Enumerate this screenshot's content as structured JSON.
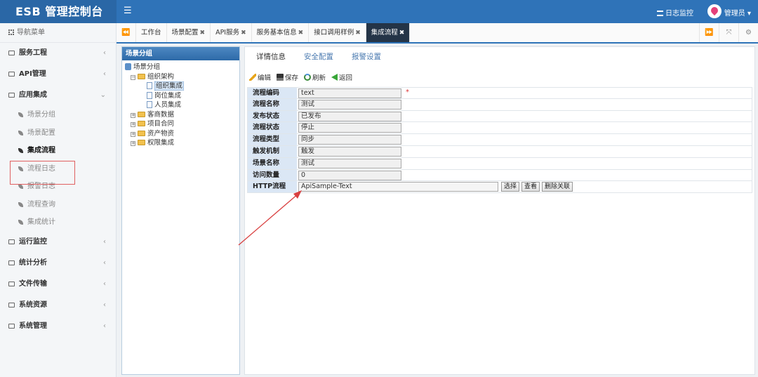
{
  "app": {
    "title": "ESB 管理控制台"
  },
  "header": {
    "menu_icon": "menu-icon",
    "log_monitor": "日志监控",
    "user": "管理员"
  },
  "sidebar": {
    "nav_title": "导航菜单",
    "groups": [
      {
        "label": "服务工程",
        "arrow": "‹"
      },
      {
        "label": "API管理",
        "arrow": "‹"
      },
      {
        "label": "应用集成",
        "arrow": "⌄",
        "expanded": true,
        "items": [
          "场景分组",
          "场景配置",
          "集成流程",
          "流程日志",
          "报警日志",
          "流程查询",
          "集成统计"
        ],
        "active": "集成流程"
      },
      {
        "label": "运行监控",
        "arrow": "‹"
      },
      {
        "label": "统计分析",
        "arrow": "‹"
      },
      {
        "label": "文件传输",
        "arrow": "‹"
      },
      {
        "label": "系统资源",
        "arrow": "‹"
      },
      {
        "label": "系统管理",
        "arrow": "‹"
      }
    ]
  },
  "tabs": [
    {
      "label": "工作台",
      "closable": false
    },
    {
      "label": "场景配置",
      "closable": true
    },
    {
      "label": "API服务",
      "closable": true
    },
    {
      "label": "服务基本信息",
      "closable": true
    },
    {
      "label": "接口调用样例",
      "closable": true
    },
    {
      "label": "集成流程",
      "closable": true,
      "active": true
    }
  ],
  "tree": {
    "title": "场景分组",
    "root": "场景分组",
    "nodes": [
      {
        "label": "组织架构",
        "expanded": true,
        "children": [
          "组织集成",
          "岗位集成",
          "人员集成"
        ],
        "selected": "组织集成"
      },
      {
        "label": "客商数据"
      },
      {
        "label": "项目合同"
      },
      {
        "label": "资产物资"
      },
      {
        "label": "权限集成"
      }
    ]
  },
  "detail": {
    "tabs": [
      "详情信息",
      "安全配置",
      "报警设置"
    ],
    "toolbar": {
      "edit": "编辑",
      "save": "保存",
      "refresh": "刷新",
      "back": "返回"
    },
    "fields": [
      {
        "label": "流程编码",
        "value": "text",
        "required": "*"
      },
      {
        "label": "流程名称",
        "value": "测试"
      },
      {
        "label": "发布状态",
        "value": "已发布"
      },
      {
        "label": "流程状态",
        "value": "停止"
      },
      {
        "label": "流程类型",
        "value": "同步"
      },
      {
        "label": "触发机制",
        "value": "触发"
      },
      {
        "label": "场景名称",
        "value": "测试"
      },
      {
        "label": "访问数量",
        "value": "0"
      },
      {
        "label": "HTTP流程",
        "value": "ApiSample-Text",
        "buttons": [
          "选择",
          "查看",
          "删除关联"
        ]
      }
    ]
  },
  "colors": {
    "header": "#2f73b8",
    "active_tab": "#243447",
    "highlight_box": "#e06060",
    "annotation_arrow": "#d94040"
  }
}
